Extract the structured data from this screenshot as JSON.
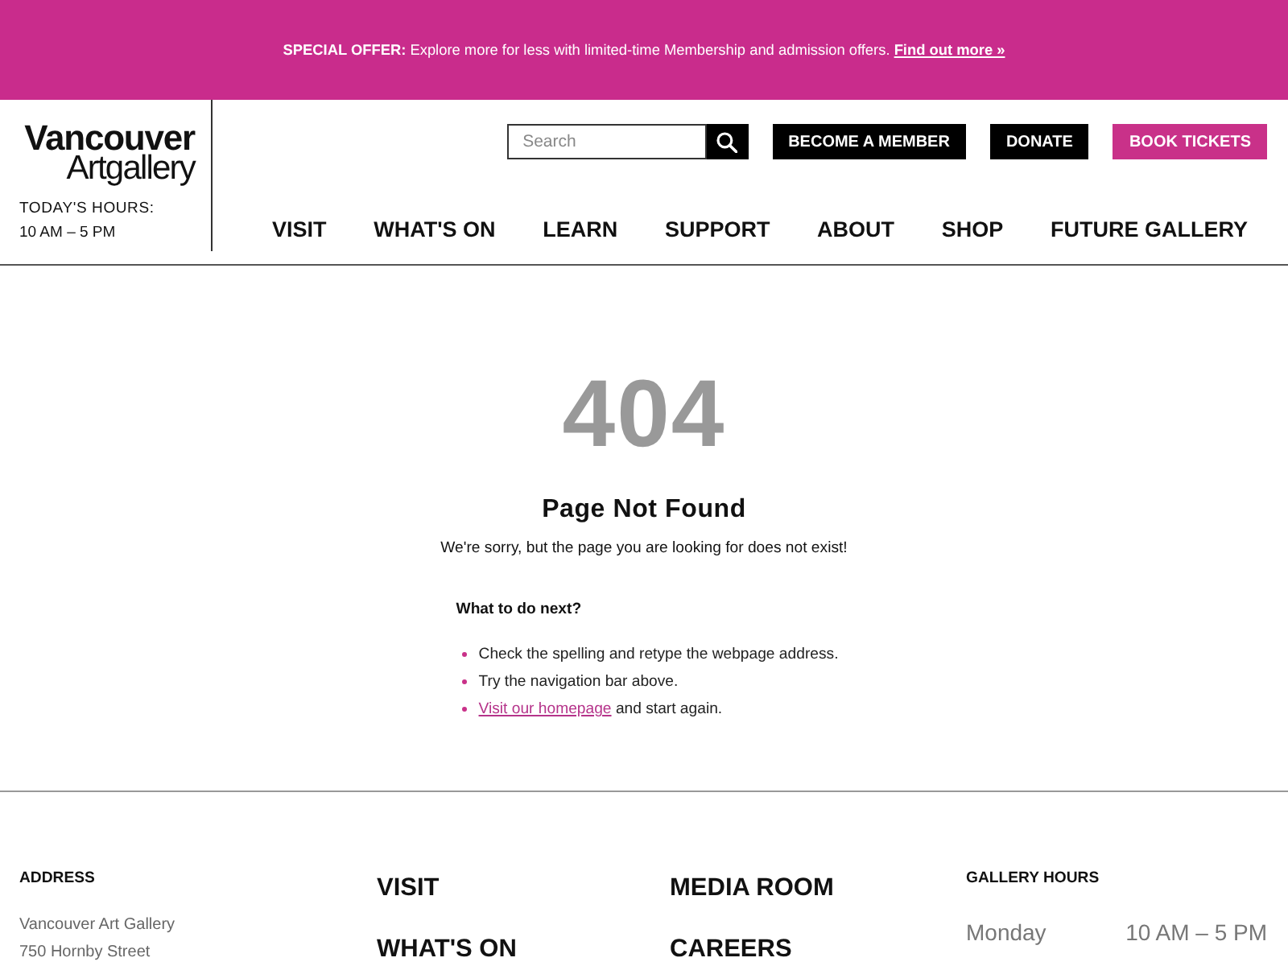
{
  "banner": {
    "text": "**SPECIAL OFFER:** Explore more for less with limited-time Membership and admission offers.",
    "link": "Find out more »"
  },
  "header": {
    "logo": {
      "line_1": "Vancouver",
      "line_2": "Artgallery"
    },
    "hours_label": "TODAY'S HOURS:",
    "hours": "10 AM – 5 PM",
    "search": {
      "placeholder": "Search"
    },
    "buttons": [
      {
        "label": "BECOME A MEMBER",
        "kind": "dark"
      },
      {
        "label": "DONATE",
        "kind": "dark"
      },
      {
        "label": "BOOK TICKETS",
        "kind": "accent"
      }
    ],
    "nav": [
      "VISIT",
      "WHAT'S ON",
      "LEARN",
      "SUPPORT",
      "ABOUT",
      "SHOP",
      "FUTURE GALLERY"
    ]
  },
  "error": {
    "code": "404",
    "title": "Page Not Found",
    "message": "We're sorry, but the page you are looking for does not exist!",
    "next_heading": "What to do next?",
    "steps": [
      {
        "text": "Check the spelling and retype the webpage address."
      },
      {
        "text": "Try the navigation bar above."
      },
      {
        "link": "Visit our homepage",
        "text": "and start again."
      }
    ]
  },
  "footer": {
    "address": {
      "heading": "ADDRESS",
      "lines": [
        "Vancouver Art Gallery",
        "750 Hornby Street"
      ]
    },
    "links_1": [
      "VISIT",
      "WHAT'S ON"
    ],
    "links_2": [
      "MEDIA ROOM",
      "CAREERS"
    ],
    "hours": {
      "heading": "GALLERY HOURS",
      "rows": [
        {
          "day": "Monday",
          "time": "10 AM – 5 PM"
        }
      ]
    }
  }
}
